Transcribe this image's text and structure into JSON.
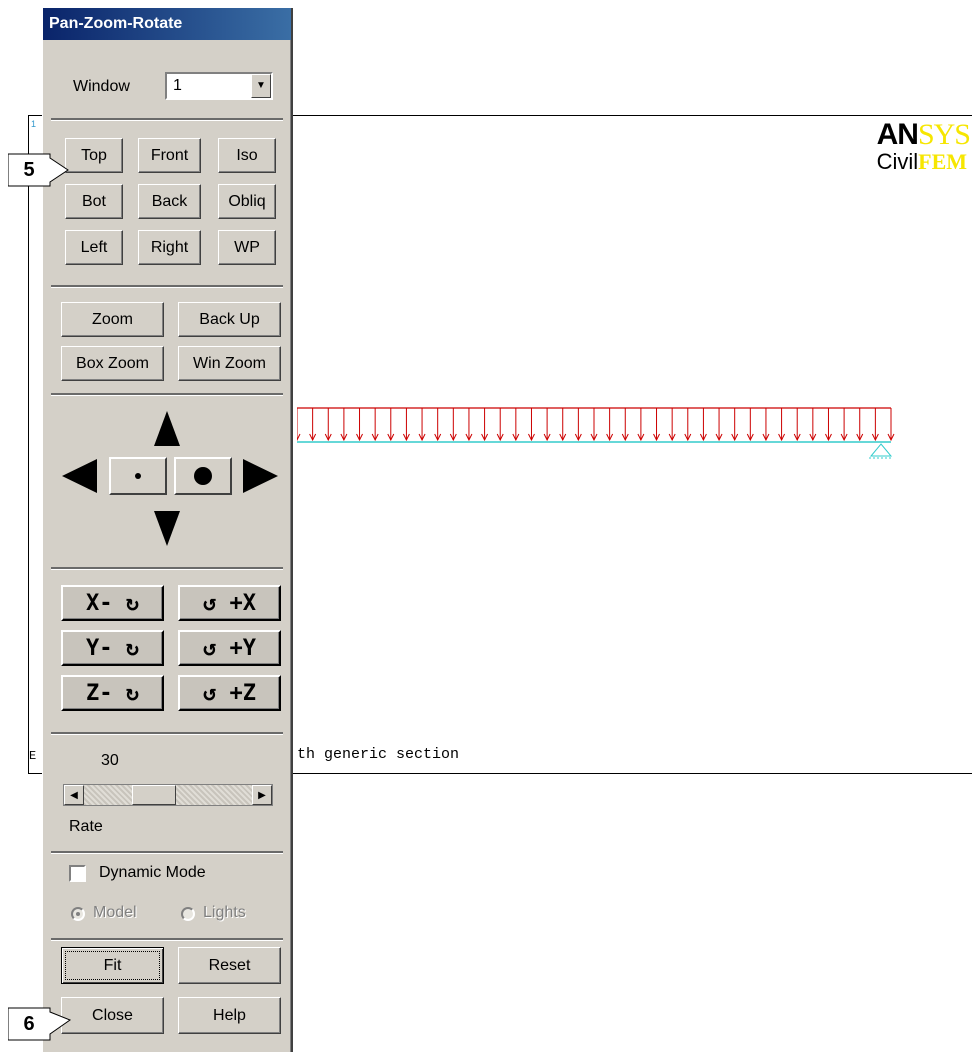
{
  "graphics": {
    "logo_line1_a": "AN",
    "logo_line1_b": "SYS",
    "logo_line2_a": "Civil",
    "logo_line2_b": "FEM",
    "title_text": "th generic section",
    "corner_top": "1",
    "corner_bottom": "E"
  },
  "dialog": {
    "title": "Pan-Zoom-Rotate",
    "window_label": "Window",
    "window_value": "1",
    "views": {
      "top": "Top",
      "front": "Front",
      "iso": "Iso",
      "bot": "Bot",
      "back": "Back",
      "obliq": "Obliq",
      "left": "Left",
      "right": "Right",
      "wp": "WP"
    },
    "zoom": {
      "zoom": "Zoom",
      "back_up": "Back Up",
      "box_zoom": "Box Zoom",
      "win_zoom": "Win Zoom"
    },
    "rotate": {
      "x_minus": "X- ↻",
      "x_plus": "↺ +X",
      "y_minus": "Y- ↻",
      "y_plus": "↺ +Y",
      "z_minus": "Z- ↻",
      "z_plus": "↺ +Z"
    },
    "rate_value": "30",
    "rate_label": "Rate",
    "dynamic_mode": "Dynamic Mode",
    "model": "Model",
    "lights": "Lights",
    "fit": "Fit",
    "reset": "Reset",
    "close": "Close",
    "help": "Help"
  },
  "callouts": {
    "c5": "5",
    "c6": "6"
  },
  "icons": [
    "dropdown-arrow-icon",
    "pan-up-icon",
    "pan-left-icon",
    "pan-right-icon",
    "pan-down-icon",
    "zoom-out-dot-icon",
    "zoom-in-dot-icon",
    "scroll-left-icon",
    "scroll-right-icon"
  ],
  "colors": {
    "load_arrows": "#cc0000",
    "beam": "#33cccc",
    "logo_yellow": "#f6e600",
    "title_bar": "#0a246a"
  }
}
